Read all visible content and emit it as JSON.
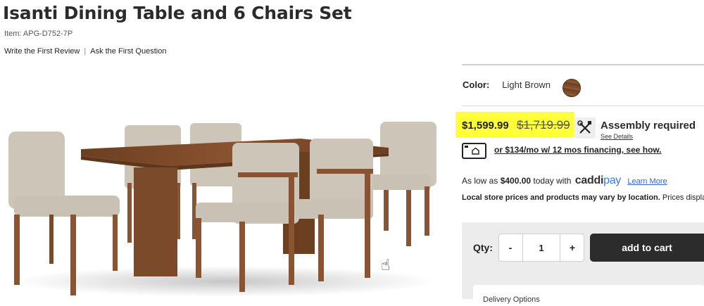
{
  "product": {
    "title": "Isanti Dining Table and 6 Chairs Set",
    "item": "Item: APG-D752-7P"
  },
  "reviews": {
    "write_review": "Write the First Review",
    "separator": "|",
    "ask_question": "Ask the First Question"
  },
  "color": {
    "label": "Color:",
    "value": "Light Brown",
    "swatch_hex": "#7a4a2a"
  },
  "price": {
    "current": "$1,599.99",
    "original": "$1,719.99",
    "highlight_hex": "#ffff3a"
  },
  "assembly": {
    "title": "Assembly required",
    "details_link": "See Details",
    "icon": "tools-icon"
  },
  "financing": {
    "icon": "payment-card-icon",
    "text": "or $134/mo w/ 12 mos financing, see how."
  },
  "caddipay": {
    "prefix": "As low as ",
    "amount": "$400.00",
    "suffix": " today with",
    "logo_a": "caddi",
    "logo_b": "pay",
    "learn_more": "Learn More"
  },
  "local": {
    "bold": "Local store prices and products may vary by location.",
    "rest": " Prices display"
  },
  "cart": {
    "qty_label": "Qty:",
    "minus": "-",
    "qty_value": "1",
    "plus": "+",
    "add_to_cart": "add to cart",
    "delivery_label": "Delivery Options"
  },
  "colors": {
    "dark_button": "#2c2c2c",
    "panel_bg": "#ececec",
    "link_blue": "#3766c4"
  }
}
